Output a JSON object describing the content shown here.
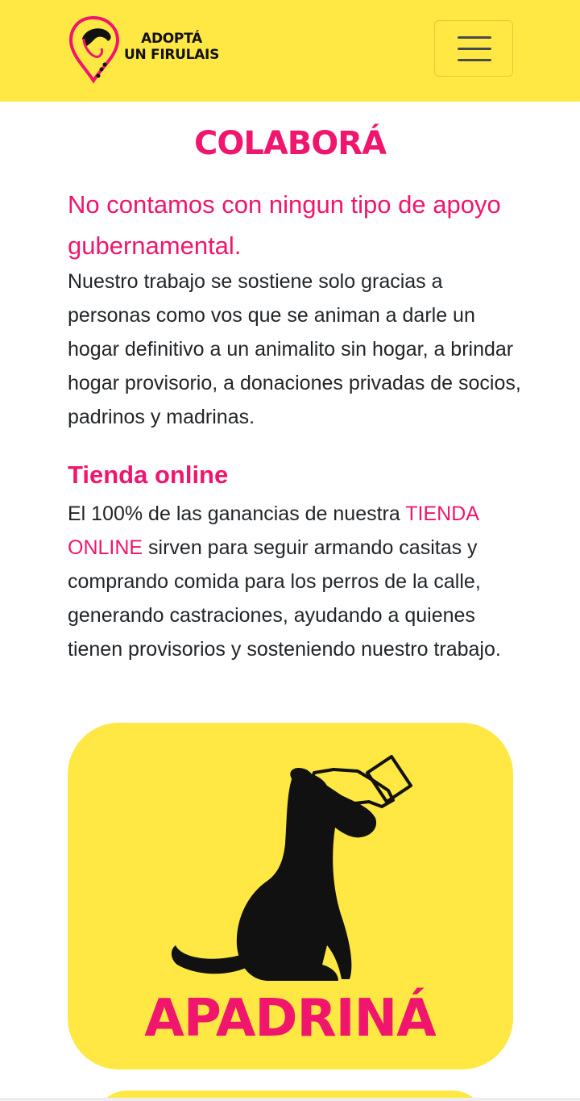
{
  "header": {
    "logo_line1": "ADOPTÁ",
    "logo_line2": "UN FIRULAIS",
    "menu_icon": "hamburger-icon"
  },
  "main": {
    "title": "COLABORÁ",
    "lead": "No contamos con ningun tipo de apoyo gubernamental.",
    "paragraph1": "Nuestro trabajo se sostiene solo gracias a personas como vos que se animan a darle un hogar definitivo a un animalito sin hogar, a brindar hogar provisorio, a donaciones privadas de socios, padrinos y madrinas.",
    "shop_heading": "Tienda online",
    "shop_text_before": "El 100% de las ganancias de nuestra ",
    "shop_link": "TIENDA ONLINE",
    "shop_text_after": " sirven para seguir armando casitas y comprando comida para los perros de la calle, generando castraciones, ayudando a quienes tienen provisorios y sosteniendo nuestro trabajo.",
    "sponsor_card_label": "APADRINÁ",
    "sponsor_card_icon": "dog-petting-icon"
  },
  "colors": {
    "brand_yellow": "#ffe843",
    "brand_pink": "#f0166d",
    "text": "#212529"
  }
}
